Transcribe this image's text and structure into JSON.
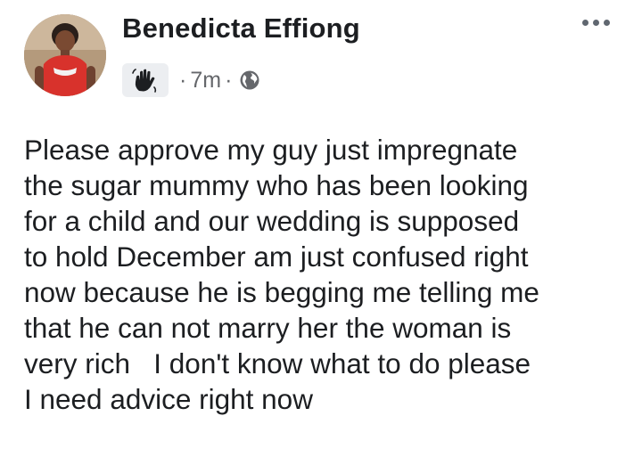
{
  "post": {
    "author_name": "Benedicta Effiong",
    "timestamp": "7m",
    "separator": "·",
    "badge_icon": "waving-hand-icon",
    "audience_icon": "globe-icon",
    "menu_icon": "more-options-icon",
    "body_lines": [
      "Please approve my guy just impregnate",
      "the sugar mummy who has been looking",
      "for a child and our wedding is supposed",
      "to hold December am just confused right",
      "now because he is begging me telling me",
      "that he can not marry her the woman is",
      "very rich   I don't know what to do please",
      "I need advice right now"
    ]
  },
  "colors": {
    "text": "#1c1e21",
    "meta": "#65676b",
    "badge_bg": "#eceef1",
    "background": "#ffffff"
  }
}
